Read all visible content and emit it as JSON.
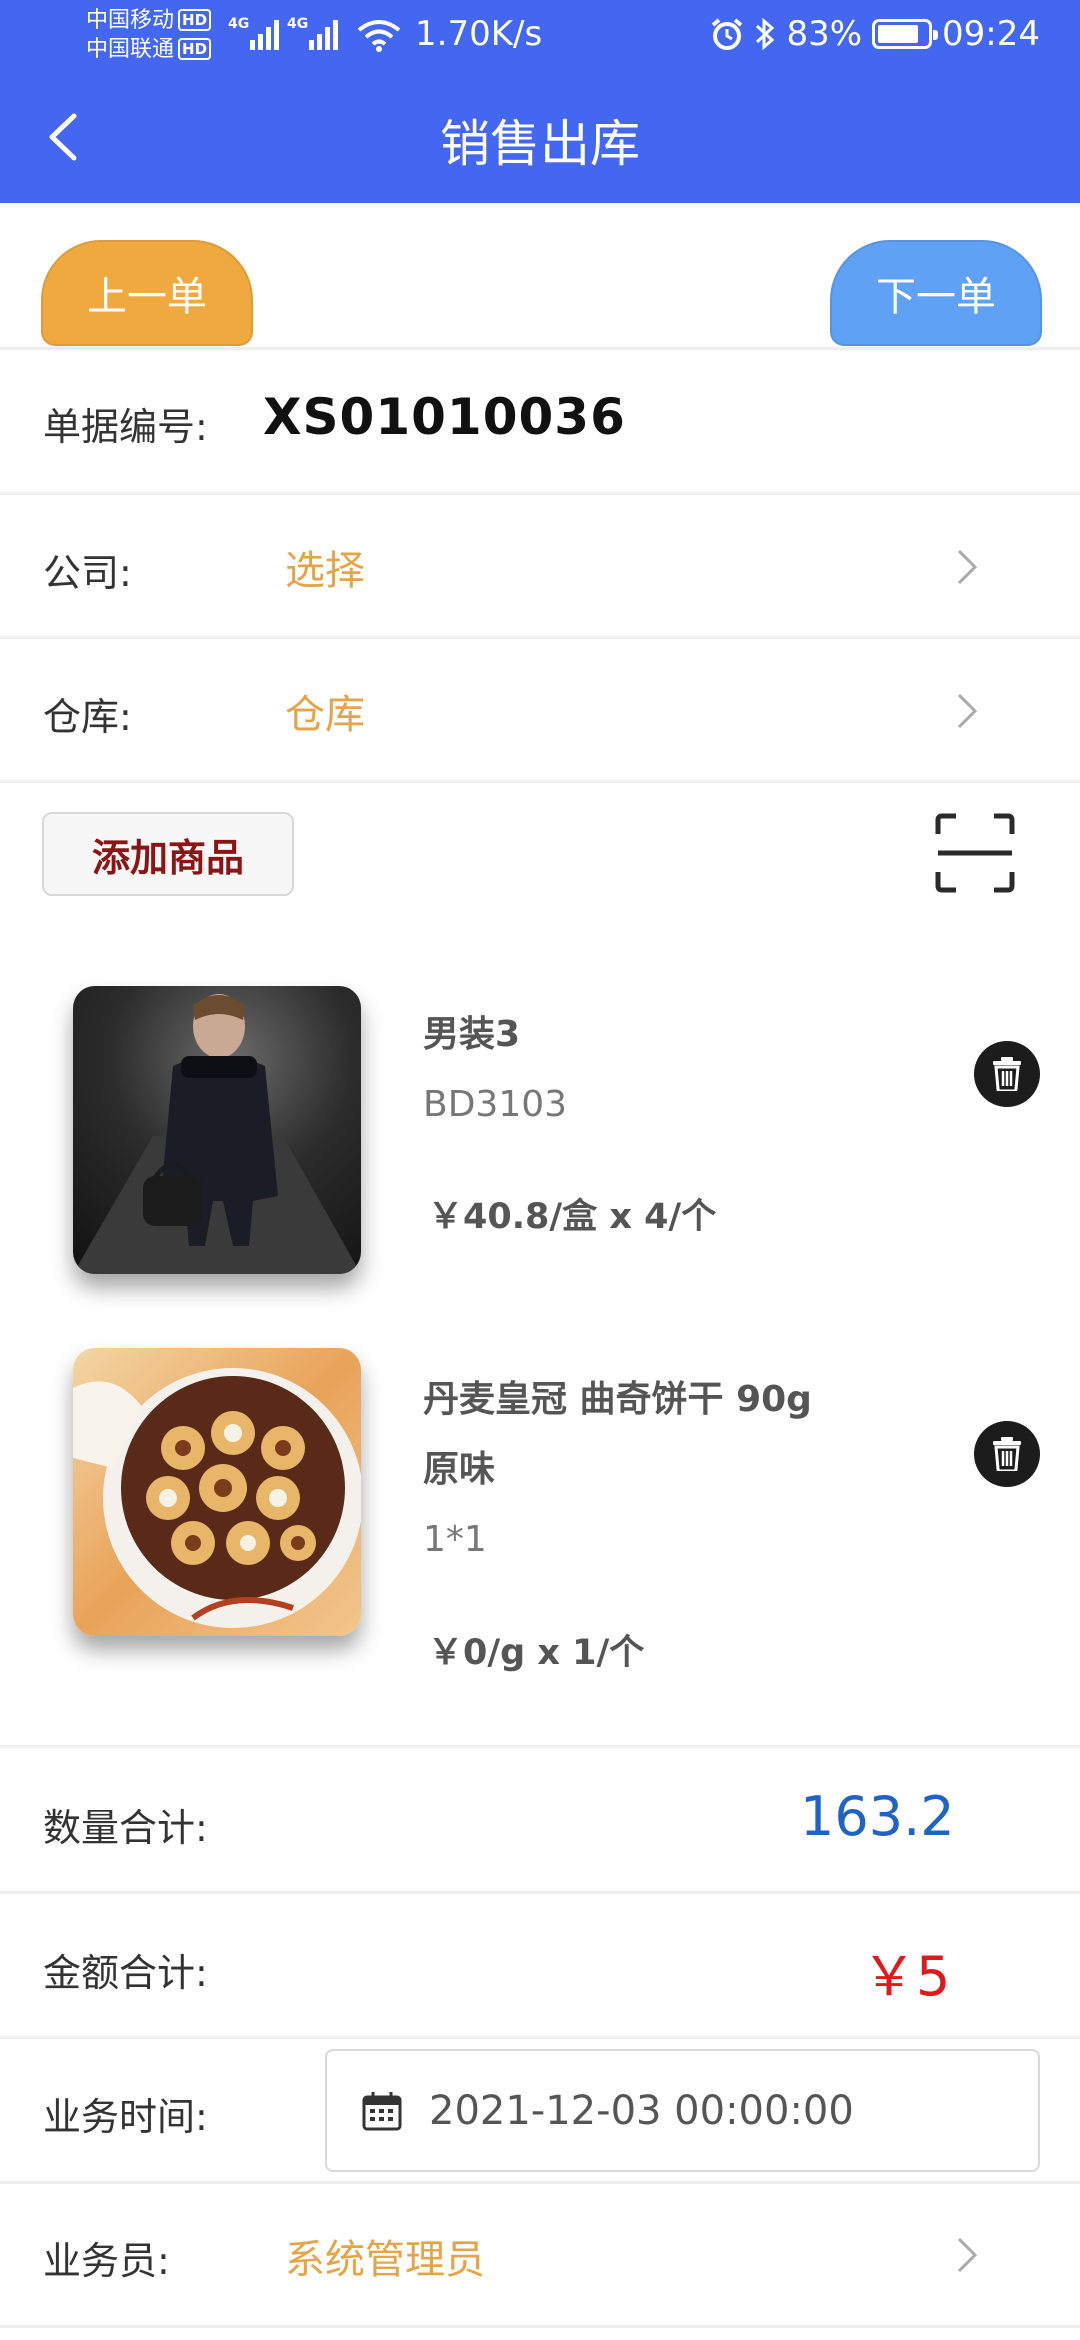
{
  "status_bar": {
    "carrier1": "中国移动",
    "carrier2": "中国联通",
    "hd": "HD",
    "net": "4G",
    "speed": "1.70K/s",
    "battery": "83%",
    "battery_level": 0.83,
    "time": "09:24"
  },
  "header": {
    "title": "销售出库",
    "color": "#4467f2"
  },
  "nav": {
    "prev_label": "上一单",
    "next_label": "下一单"
  },
  "form": {
    "doc_no_label": "单据编号:",
    "doc_no": "XS01010036",
    "company_label": "公司:",
    "company_value": "选择",
    "warehouse_label": "仓库:",
    "warehouse_value": "仓库"
  },
  "actions": {
    "add_goods": "添加商品"
  },
  "products": [
    {
      "name": "男装3",
      "code": "BD3103",
      "price": "￥40.8/盒 x 4/个"
    },
    {
      "name_line1": "丹麦皇冠 曲奇饼干 90g",
      "name_line2": "原味",
      "code": "1*1",
      "price": "￥0/g x 1/个"
    }
  ],
  "summary": {
    "qty_label": "数量合计:",
    "qty_value": "163.2",
    "amount_label": "金额合计:",
    "amount_value": "￥5",
    "time_label": "业务时间:",
    "time_value": "2021-12-03 00:00:00",
    "salesman_label": "业务员:",
    "salesman_value": "系统管理员"
  }
}
